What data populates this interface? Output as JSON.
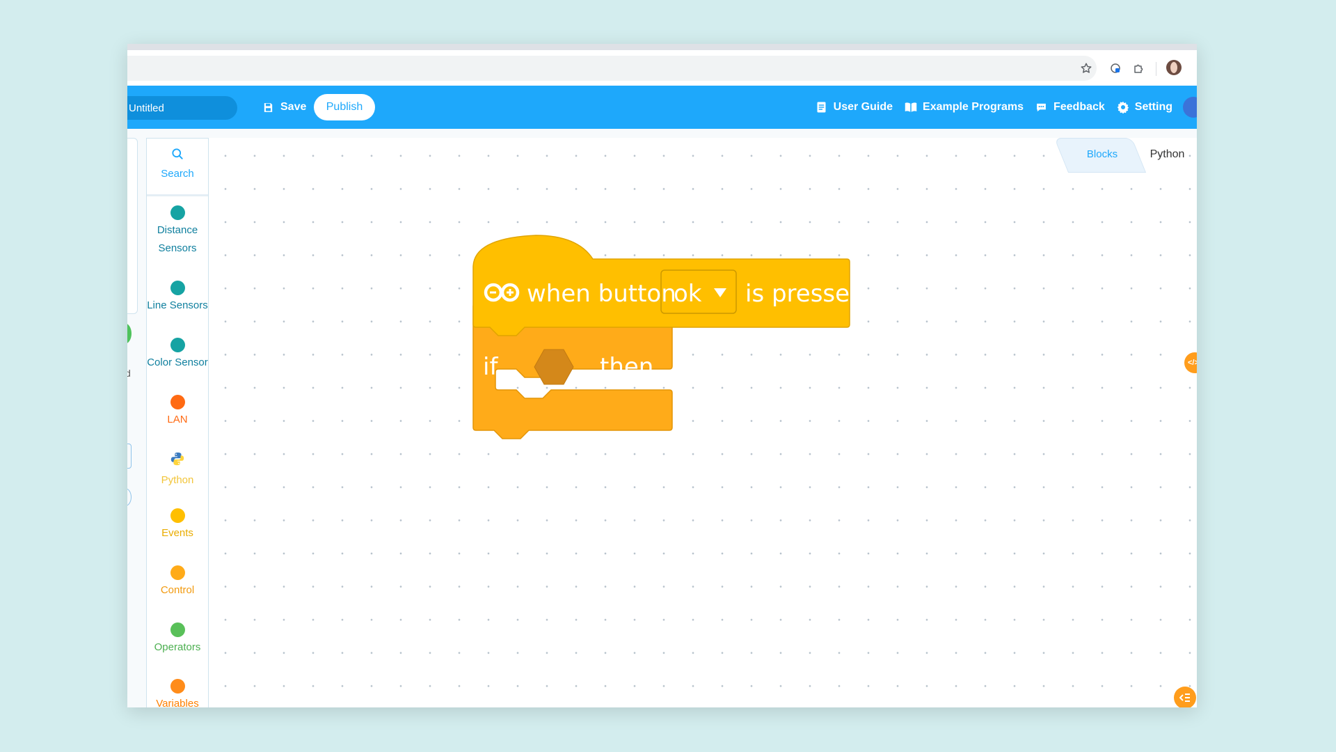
{
  "app": {
    "project_title": "Untitled",
    "save_label": "Save",
    "publish_label": "Publish"
  },
  "nav": {
    "user_guide": "User Guide",
    "example_programs": "Example Programs",
    "feedback": "Feedback",
    "setting": "Setting"
  },
  "palette": {
    "search": "Search",
    "categories": [
      {
        "label": "Distance\nSensors",
        "color": "#16a3a3",
        "icon": "dot"
      },
      {
        "label": "Line Sensors",
        "color": "#16a3a3",
        "icon": "dot"
      },
      {
        "label": "Color Sensor",
        "color": "#16a3a3",
        "icon": "dot"
      },
      {
        "label": "LAN",
        "color": "#ff6a13",
        "icon": "dot"
      },
      {
        "label": "Python",
        "color": "#ffc93d",
        "icon": "python-logo"
      },
      {
        "label": "Events",
        "color": "#ffbf00",
        "icon": "dot"
      },
      {
        "label": "Control",
        "color": "#ffab19",
        "icon": "dot"
      },
      {
        "label": "Operators",
        "color": "#59c059",
        "icon": "dot"
      },
      {
        "label": "Variables",
        "color": "#ff8c1a",
        "icon": "dot"
      }
    ]
  },
  "tabs": {
    "blocks": "Blocks",
    "python": "Python",
    "active": "Blocks"
  },
  "blocks": {
    "hat": {
      "prefix": "when button",
      "dropdown_value": "ok",
      "suffix": "is pressed",
      "color": "#ffbf00"
    },
    "if_block": {
      "if_label": "if",
      "then_label": "then",
      "color": "#ffab19"
    }
  },
  "icons": {
    "side_toggle": "</>",
    "corner_button": "list-collapse-icon"
  }
}
